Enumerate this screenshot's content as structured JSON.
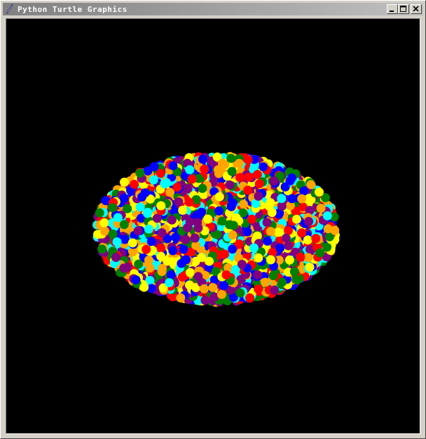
{
  "window": {
    "title": "Python Turtle Graphics",
    "icon": "feather-pen-icon",
    "buttons": {
      "minimize": "minimize-icon",
      "maximize": "maximize-icon",
      "close": "close-icon"
    }
  },
  "canvas": {
    "background": "#000000",
    "dot_colors": [
      "#ff0000",
      "#ffff00",
      "#00ffff",
      "#0000ff",
      "#008000",
      "#ffa500",
      "#800080"
    ]
  }
}
